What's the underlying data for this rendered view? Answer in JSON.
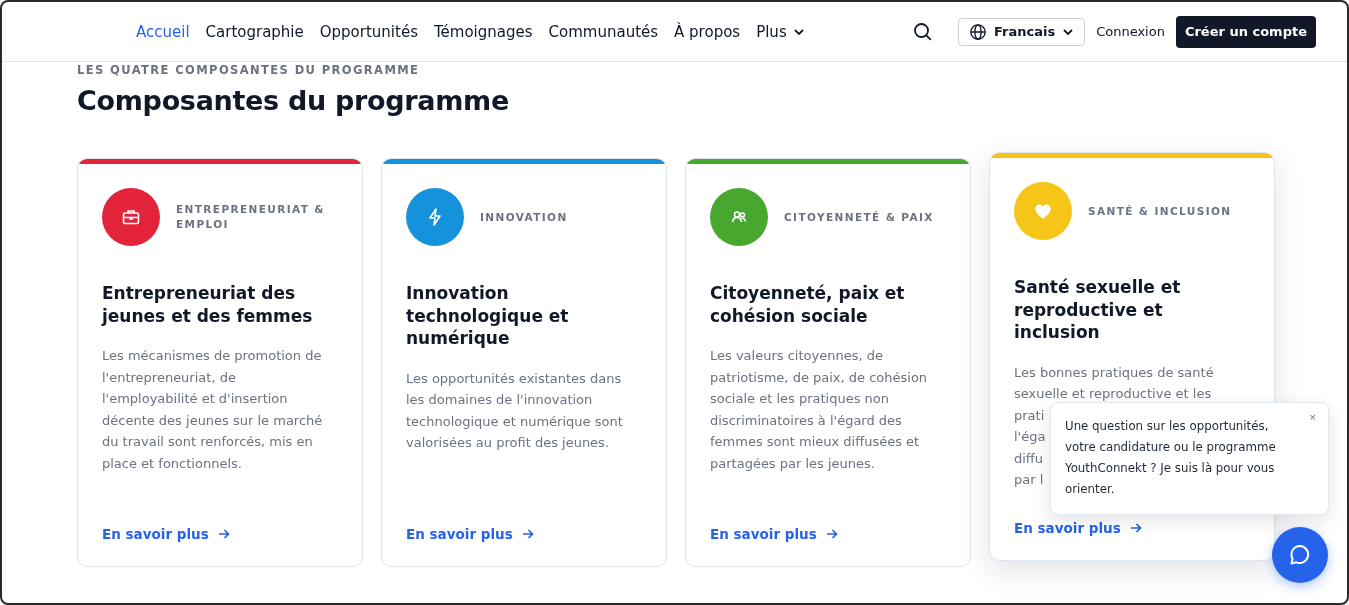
{
  "nav": {
    "links": [
      {
        "label": "Accueil",
        "selected": true,
        "kind": "link"
      },
      {
        "label": "Cartographie",
        "selected": false,
        "kind": "link"
      },
      {
        "label": "Opportunités",
        "selected": false,
        "kind": "link"
      },
      {
        "label": "Témoignages",
        "selected": false,
        "kind": "link"
      },
      {
        "label": "Communautés",
        "selected": false,
        "kind": "link"
      },
      {
        "label": "À propos",
        "selected": false,
        "kind": "link"
      },
      {
        "label": "Plus",
        "selected": false,
        "kind": "dropdown"
      }
    ],
    "language": "Francais",
    "login": "Connexion",
    "signup": "Créer un compte"
  },
  "section": {
    "eyebrow": "LES QUATRE COMPOSANTES DU PROGRAMME",
    "title": "Composantes du programme",
    "cards": [
      {
        "color": "#e3233a",
        "raised": false,
        "category": [
          "ENTREPRENEURIAT &",
          "EMPLOI"
        ],
        "title": [
          "Entrepreneuriat des",
          "jeunes et des femmes"
        ],
        "description": [
          "Les mécanismes de promotion de",
          "l'entrepreneuriat, de",
          "l'employabilité et d'insertion",
          "décente des jeunes sur le marché",
          "du travail sont renforcés, mis en",
          "place et fonctionnels."
        ],
        "link": "En savoir plus"
      },
      {
        "color": "#1592dc",
        "raised": false,
        "category": [
          "INNOVATION"
        ],
        "title": [
          "Innovation",
          "technologique et",
          "numérique"
        ],
        "description": [
          "Les opportunités existantes dans",
          "les domaines de l'innovation",
          "technologique et numérique sont",
          "valorisées au profit des jeunes."
        ],
        "link": "En savoir plus"
      },
      {
        "color": "#47a72f",
        "raised": false,
        "category": [
          "CITOYENNETÉ & PAIX"
        ],
        "title": [
          "Citoyenneté, paix et",
          "cohésion sociale"
        ],
        "description": [
          "Les valeurs citoyennes, de",
          "patriotisme, de paix, de cohésion",
          "sociale et les pratiques non",
          "discriminatoires à l'égard des",
          "femmes sont mieux diffusées et",
          "partagées par les jeunes."
        ],
        "link": "En savoir plus"
      },
      {
        "color": "#f5c518",
        "raised": true,
        "category": [
          "SANTÉ & INCLUSION"
        ],
        "title": [
          "Santé sexuelle et",
          "reproductive et",
          "inclusion"
        ],
        "description": [
          "Les bonnes pratiques de santé",
          "sexuelle et reproductive et les",
          "prati",
          "l'éga",
          "diffu",
          "par l"
        ],
        "link": "En savoir plus"
      }
    ]
  },
  "chat": {
    "message": "Une question sur les opportunités, votre candidature ou le programme YouthConnekt ? Je suis là pour vous orienter.",
    "close": "×"
  }
}
